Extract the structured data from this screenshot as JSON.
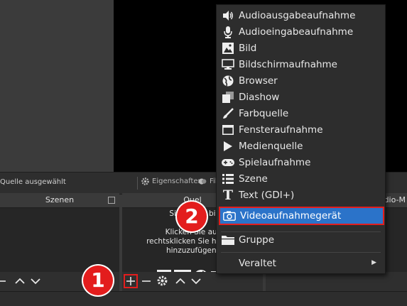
{
  "toolbar": {
    "no_source_text": "Quelle ausgewählt",
    "properties_label": "Eigenschaften",
    "filters_label": "Fil"
  },
  "docks": {
    "scenes_title": "Szenen",
    "sources_title": "Quel",
    "audio_title": "udio-M"
  },
  "sources_hint": [
    "Sie haben bi",
    "hi",
    "Klicken Sie auf",
    "rechtsklicken Sie hier, ur",
    "hinzuzufügen."
  ],
  "menu": {
    "items": [
      {
        "label": "Audioausgabeaufnahme",
        "icon": "speaker-icon"
      },
      {
        "label": "Audioeingabeaufnahme",
        "icon": "microphone-icon"
      },
      {
        "label": "Bild",
        "icon": "image-icon"
      },
      {
        "label": "Bildschirmaufnahme",
        "icon": "monitor-icon"
      },
      {
        "label": "Browser",
        "icon": "globe-icon"
      },
      {
        "label": "Diashow",
        "icon": "slideshow-icon"
      },
      {
        "label": "Farbquelle",
        "icon": "brush-icon"
      },
      {
        "label": "Fensteraufnahme",
        "icon": "window-icon"
      },
      {
        "label": "Medienquelle",
        "icon": "play-icon"
      },
      {
        "label": "Spielaufnahme",
        "icon": "gamepad-icon"
      },
      {
        "label": "Szene",
        "icon": "list-icon"
      },
      {
        "label": "Text (GDI+)",
        "icon": "text-icon"
      },
      {
        "label": "Videoaufnahmegerät",
        "icon": "camera-icon"
      }
    ],
    "group_label": "Gruppe",
    "deprecated_label": "Veraltet",
    "highlighted": "Videoaufnahmegerät"
  },
  "badges": {
    "step1": "1",
    "step2": "2"
  },
  "colors": {
    "highlight": "#2b73c9",
    "annotation": "#e31d1d",
    "menu_bg": "#2d2d2d",
    "preview_bg": "#000000"
  }
}
